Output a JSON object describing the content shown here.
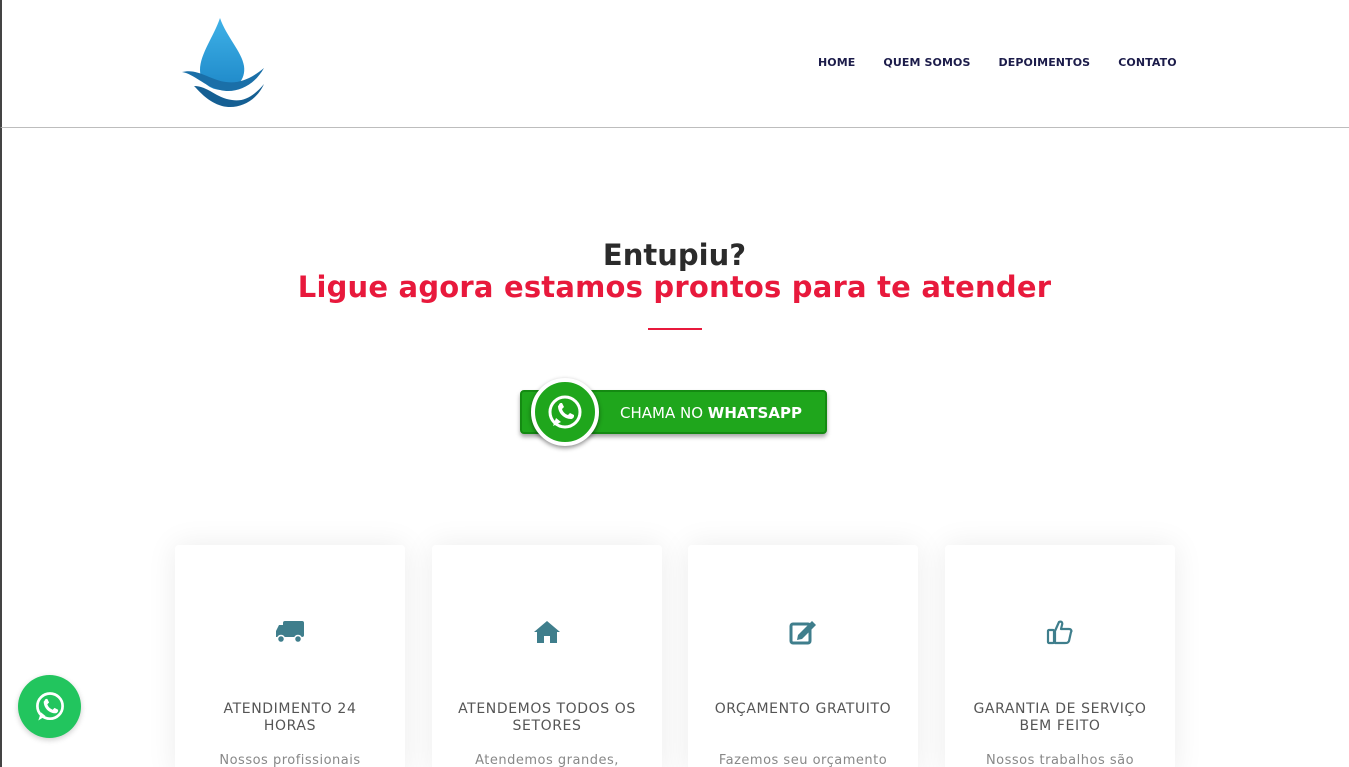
{
  "nav": {
    "items": [
      {
        "label": "HOME"
      },
      {
        "label": "QUEM SOMOS"
      },
      {
        "label": "DEPOIMENTOS"
      },
      {
        "label": "CONTATO"
      }
    ]
  },
  "hero": {
    "title": "Entupiu?",
    "subtitle": "Ligue agora estamos prontos para te atender",
    "accent_color": "#e8193c"
  },
  "whatsapp_button": {
    "label_light": "CHAMA NO ",
    "label_bold": "WHATSAPP",
    "color": "#1fa61c"
  },
  "features": [
    {
      "icon": "truck-icon",
      "title": "ATENDIMENTO 24 HORAS",
      "text": "Nossos profissionais"
    },
    {
      "icon": "home-icon",
      "title": "ATENDEMOS TODOS OS SETORES",
      "text": "Atendemos grandes,"
    },
    {
      "icon": "edit-icon",
      "title": "ORÇAMENTO GRATUITO",
      "text": "Fazemos seu orçamento"
    },
    {
      "icon": "thumbs-up-icon",
      "title": "GARANTIA DE SERVIÇO BEM FEITO",
      "text": "Nossos trabalhos são"
    }
  ],
  "icon_color": "#3f7e8c",
  "floating_whatsapp": {
    "icon": "whatsapp-icon",
    "color": "#22c55e"
  }
}
